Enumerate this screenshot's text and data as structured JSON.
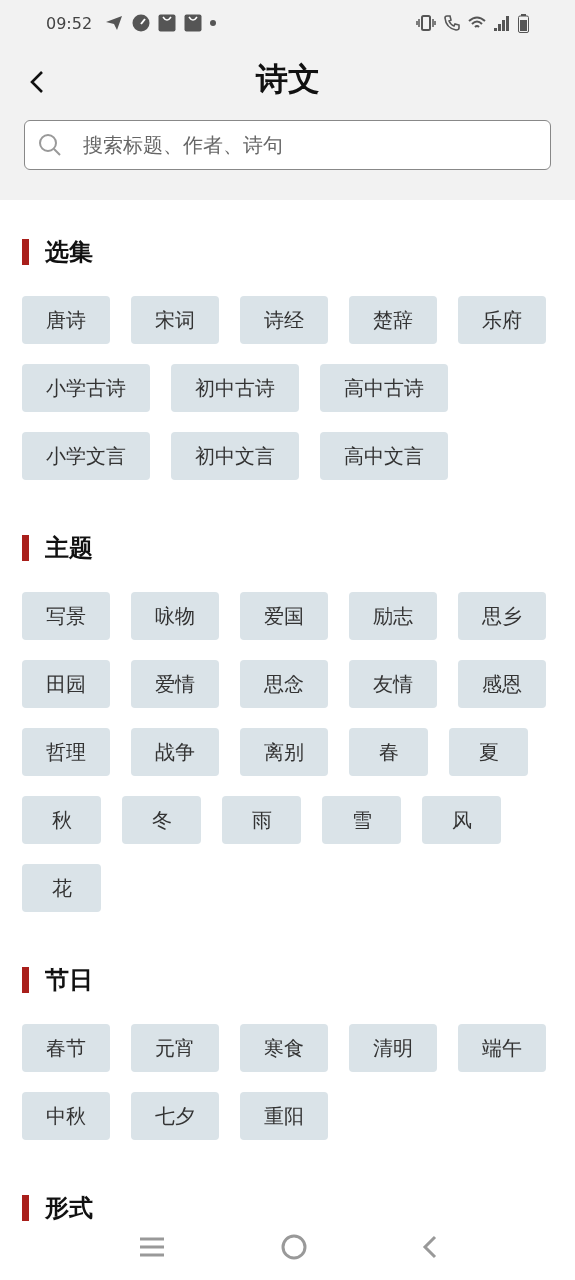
{
  "status_bar": {
    "time": "09:52"
  },
  "header": {
    "title": "诗文"
  },
  "search": {
    "placeholder": "搜索标题、作者、诗句"
  },
  "sections": [
    {
      "title": "选集",
      "tags": [
        "唐诗",
        "宋词",
        "诗经",
        "楚辞",
        "乐府",
        "小学古诗",
        "初中古诗",
        "高中古诗",
        "小学文言",
        "初中文言",
        "高中文言"
      ]
    },
    {
      "title": "主题",
      "tags": [
        "写景",
        "咏物",
        "爱国",
        "励志",
        "思乡",
        "田园",
        "爱情",
        "思念",
        "友情",
        "感恩",
        "哲理",
        "战争",
        "离别",
        "春",
        "夏",
        "秋",
        "冬",
        "雨",
        "雪",
        "风",
        "花"
      ]
    },
    {
      "title": "节日",
      "tags": [
        "春节",
        "元宵",
        "寒食",
        "清明",
        "端午",
        "中秋",
        "七夕",
        "重阳"
      ]
    },
    {
      "title": "形式"
    }
  ]
}
